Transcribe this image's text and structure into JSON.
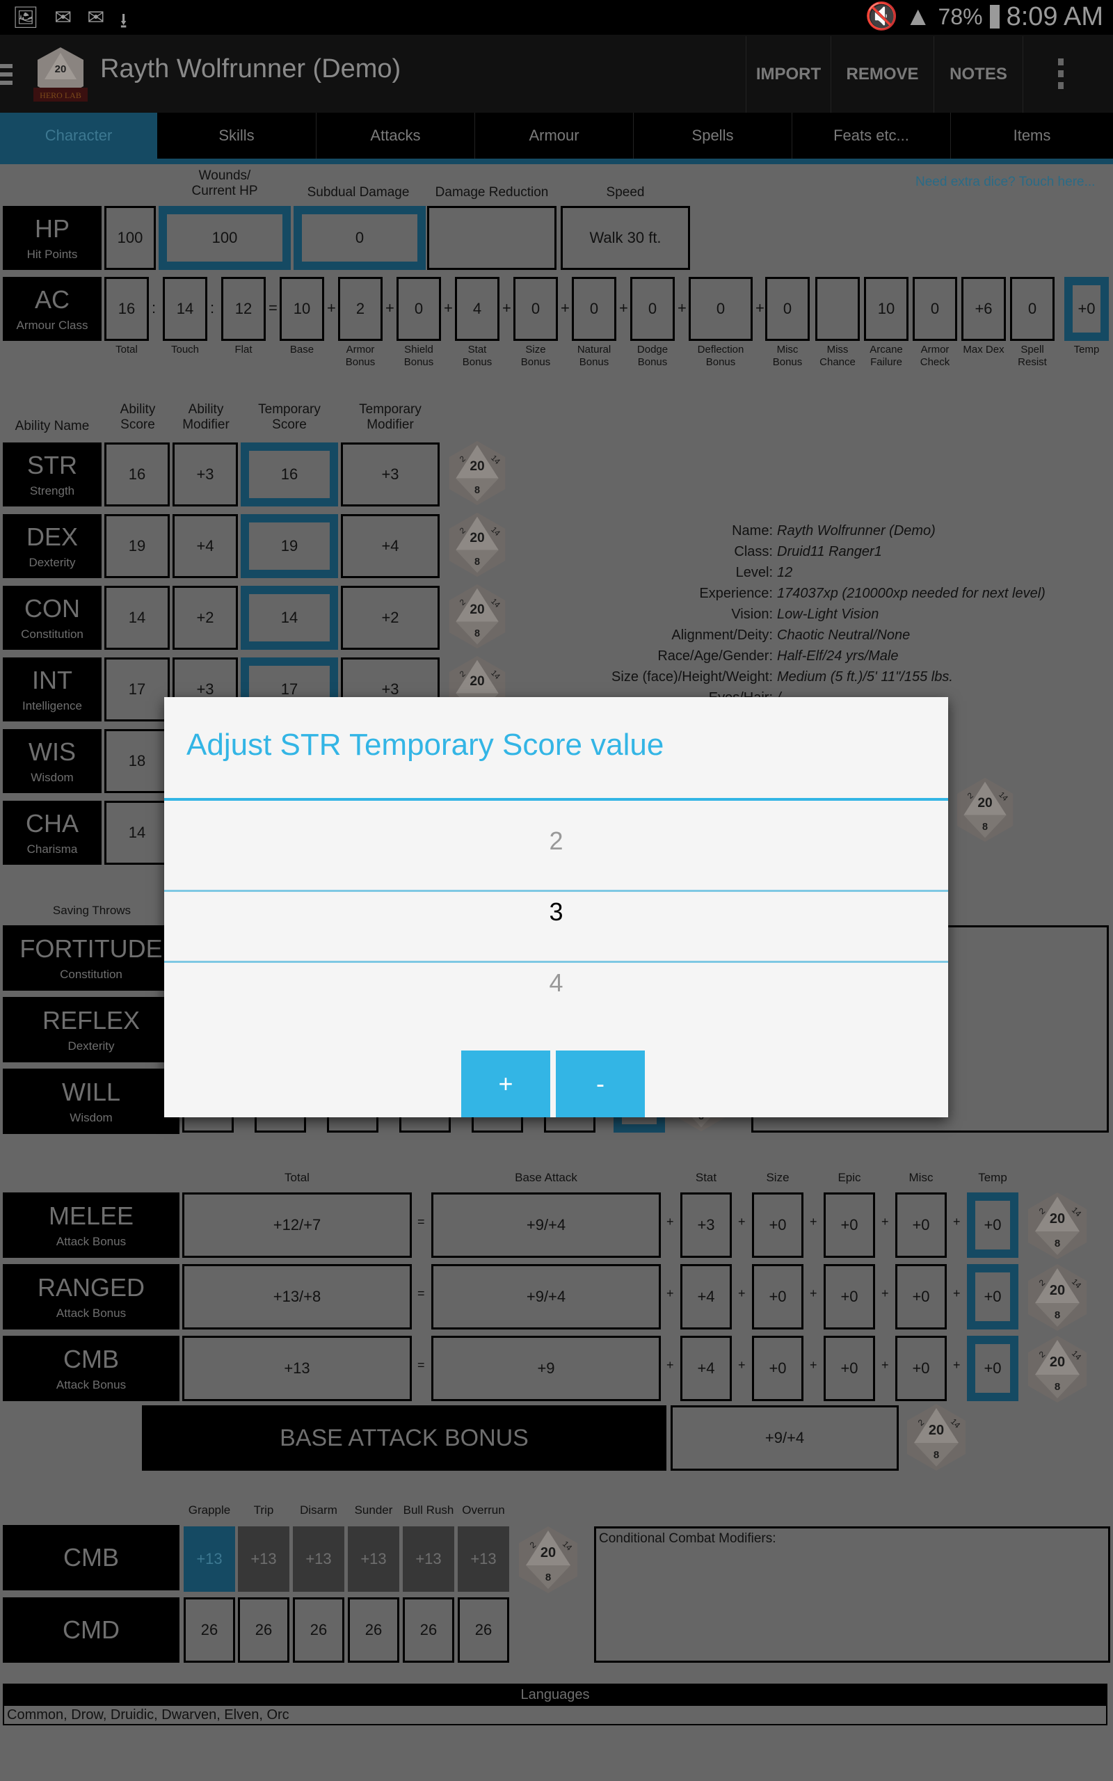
{
  "status_bar": {
    "left_icons": [
      "gallery-icon",
      "outlook-icon",
      "email-icon",
      "download-icon"
    ],
    "battery_percent": "78%",
    "time": "8:09 AM"
  },
  "action_bar": {
    "title": "Rayth Wolfrunner (Demo)",
    "logo_text": "HERO LAB",
    "buttons": [
      "IMPORT",
      "REMOVE",
      "NOTES"
    ]
  },
  "tabs": [
    {
      "label": "Character",
      "active": true
    },
    {
      "label": "Skills",
      "active": false
    },
    {
      "label": "Attacks",
      "active": false
    },
    {
      "label": "Armour",
      "active": false
    },
    {
      "label": "Spells",
      "active": false
    },
    {
      "label": "Feats etc...",
      "active": false
    },
    {
      "label": "Items",
      "active": false
    }
  ],
  "hp": {
    "label": "HP",
    "sublabel": "Hit Points",
    "headers": {
      "wounds": "Wounds/\nCurrent HP",
      "subdual": "Subdual Damage",
      "dr": "Damage Reduction",
      "speed": "Speed"
    },
    "max": "100",
    "current": "100",
    "subdual": "0",
    "dr": "",
    "speed": "Walk 30 ft."
  },
  "extra_dice_link": "Need extra dice?  Touch here...",
  "ac": {
    "label": "AC",
    "sublabel": "Armour Class",
    "cells": [
      {
        "label": "Total",
        "value": "16"
      },
      {
        "label": "Touch",
        "value": "14"
      },
      {
        "label": "Flat",
        "value": "12"
      },
      {
        "label": "Base",
        "value": "10"
      },
      {
        "label": "Armor\nBonus",
        "value": "2"
      },
      {
        "label": "Shield\nBonus",
        "value": "0"
      },
      {
        "label": "Stat\nBonus",
        "value": "4"
      },
      {
        "label": "Size\nBonus",
        "value": "0"
      },
      {
        "label": "Natural\nBonus",
        "value": "0"
      },
      {
        "label": "Dodge\nBonus",
        "value": "0"
      },
      {
        "label": "Deflection\nBonus",
        "value": "0"
      },
      {
        "label": "Misc\nBonus",
        "value": "0"
      },
      {
        "label": "Miss\nChance",
        "value": ""
      },
      {
        "label": "Arcane\nFailure",
        "value": "10"
      },
      {
        "label": "Armor\nCheck",
        "value": "0"
      },
      {
        "label": "Max Dex",
        "value": "+6"
      },
      {
        "label": "Spell\nResist",
        "value": "0"
      },
      {
        "label": "Temp",
        "value": "+0"
      }
    ],
    "operators": [
      ":",
      ":",
      "=",
      "+",
      "+",
      "+",
      "+",
      "+",
      "+",
      "+",
      "+"
    ]
  },
  "abilities": {
    "headers": [
      "Ability Name",
      "Ability\nScore",
      "Ability\nModifier",
      "Temporary\nScore",
      "Temporary\nModifier"
    ],
    "rows": [
      {
        "abbr": "STR",
        "name": "Strength",
        "score": "16",
        "mod": "+3",
        "temp_score": "16",
        "temp_mod": "+3"
      },
      {
        "abbr": "DEX",
        "name": "Dexterity",
        "score": "19",
        "mod": "+4",
        "temp_score": "19",
        "temp_mod": "+4"
      },
      {
        "abbr": "CON",
        "name": "Constitution",
        "score": "14",
        "mod": "+2",
        "temp_score": "14",
        "temp_mod": "+2"
      },
      {
        "abbr": "INT",
        "name": "Intelligence",
        "score": "17",
        "mod": "+3",
        "temp_score": "17",
        "temp_mod": "+3"
      },
      {
        "abbr": "WIS",
        "name": "Wisdom",
        "score": "18",
        "mod": "",
        "temp_score": "",
        "temp_mod": ""
      },
      {
        "abbr": "CHA",
        "name": "Charisma",
        "score": "14",
        "mod": "",
        "temp_score": "",
        "temp_mod": ""
      }
    ]
  },
  "character_info": [
    {
      "key": "Name:",
      "value": "Rayth Wolfrunner (Demo)"
    },
    {
      "key": "Class:",
      "value": "Druid11 Ranger1"
    },
    {
      "key": "Level:",
      "value": "12"
    },
    {
      "key": "Experience:",
      "value": "174037xp (210000xp needed for next level)"
    },
    {
      "key": "Vision:",
      "value": "Low-Light Vision"
    },
    {
      "key": "Alignment/Deity:",
      "value": "Chaotic Neutral/None"
    },
    {
      "key": "Race/Age/Gender:",
      "value": "Half-Elf/24 yrs/Male"
    },
    {
      "key": "Size (face)/Height/Weight:",
      "value": "Medium (5 ft.)/5' 11\"/155 lbs."
    },
    {
      "key": "Eyes/Hair:",
      "value": "/"
    }
  ],
  "saving_throws": {
    "header": "Saving Throws",
    "rows": [
      {
        "name": "FORTITUDE",
        "stat": "Constitution"
      },
      {
        "name": "REFLEX",
        "stat": "Dexterity"
      },
      {
        "name": "WILL",
        "stat": "Wisdom"
      }
    ]
  },
  "attacks": {
    "headers": [
      "Total",
      "Base Attack",
      "Stat",
      "Size",
      "Epic",
      "Misc",
      "Temp"
    ],
    "rows": [
      {
        "name": "MELEE",
        "sub": "Attack Bonus",
        "total": "+12/+7",
        "base": "+9/+4",
        "stat": "+3",
        "size": "+0",
        "epic": "+0",
        "misc": "+0",
        "temp": "+0"
      },
      {
        "name": "RANGED",
        "sub": "Attack Bonus",
        "total": "+13/+8",
        "base": "+9/+4",
        "stat": "+4",
        "size": "+0",
        "epic": "+0",
        "misc": "+0",
        "temp": "+0"
      },
      {
        "name": "CMB",
        "sub": "Attack Bonus",
        "total": "+13",
        "base": "+9",
        "stat": "+4",
        "size": "+0",
        "epic": "+0",
        "misc": "+0",
        "temp": "+0"
      }
    ],
    "bab_label": "BASE ATTACK BONUS",
    "bab_value": "+9/+4"
  },
  "maneuvers": {
    "headers": [
      "Grapple",
      "Trip",
      "Disarm",
      "Sunder",
      "Bull Rush",
      "Overrun"
    ],
    "cmb_label": "CMB",
    "cmd_label": "CMD",
    "cmb": [
      "+13",
      "+13",
      "+13",
      "+13",
      "+13",
      "+13"
    ],
    "cmd": [
      "26",
      "26",
      "26",
      "26",
      "26",
      "26"
    ],
    "selected_index": 0
  },
  "conditional_modifiers_label": "Conditional Combat Modifiers:",
  "languages": {
    "header": "Languages",
    "value": "Common, Drow, Druidic, Dwarven, Elven, Orc"
  },
  "dialog": {
    "title": "Adjust STR Temporary Score value",
    "picker_prev": "2",
    "picker_current": "3",
    "picker_next": "4",
    "plus_label": "+",
    "minus_label": "-"
  },
  "colors": {
    "accent": "#33b5e5",
    "tab_active": "#154a63",
    "overlay_bg": "#666666"
  }
}
